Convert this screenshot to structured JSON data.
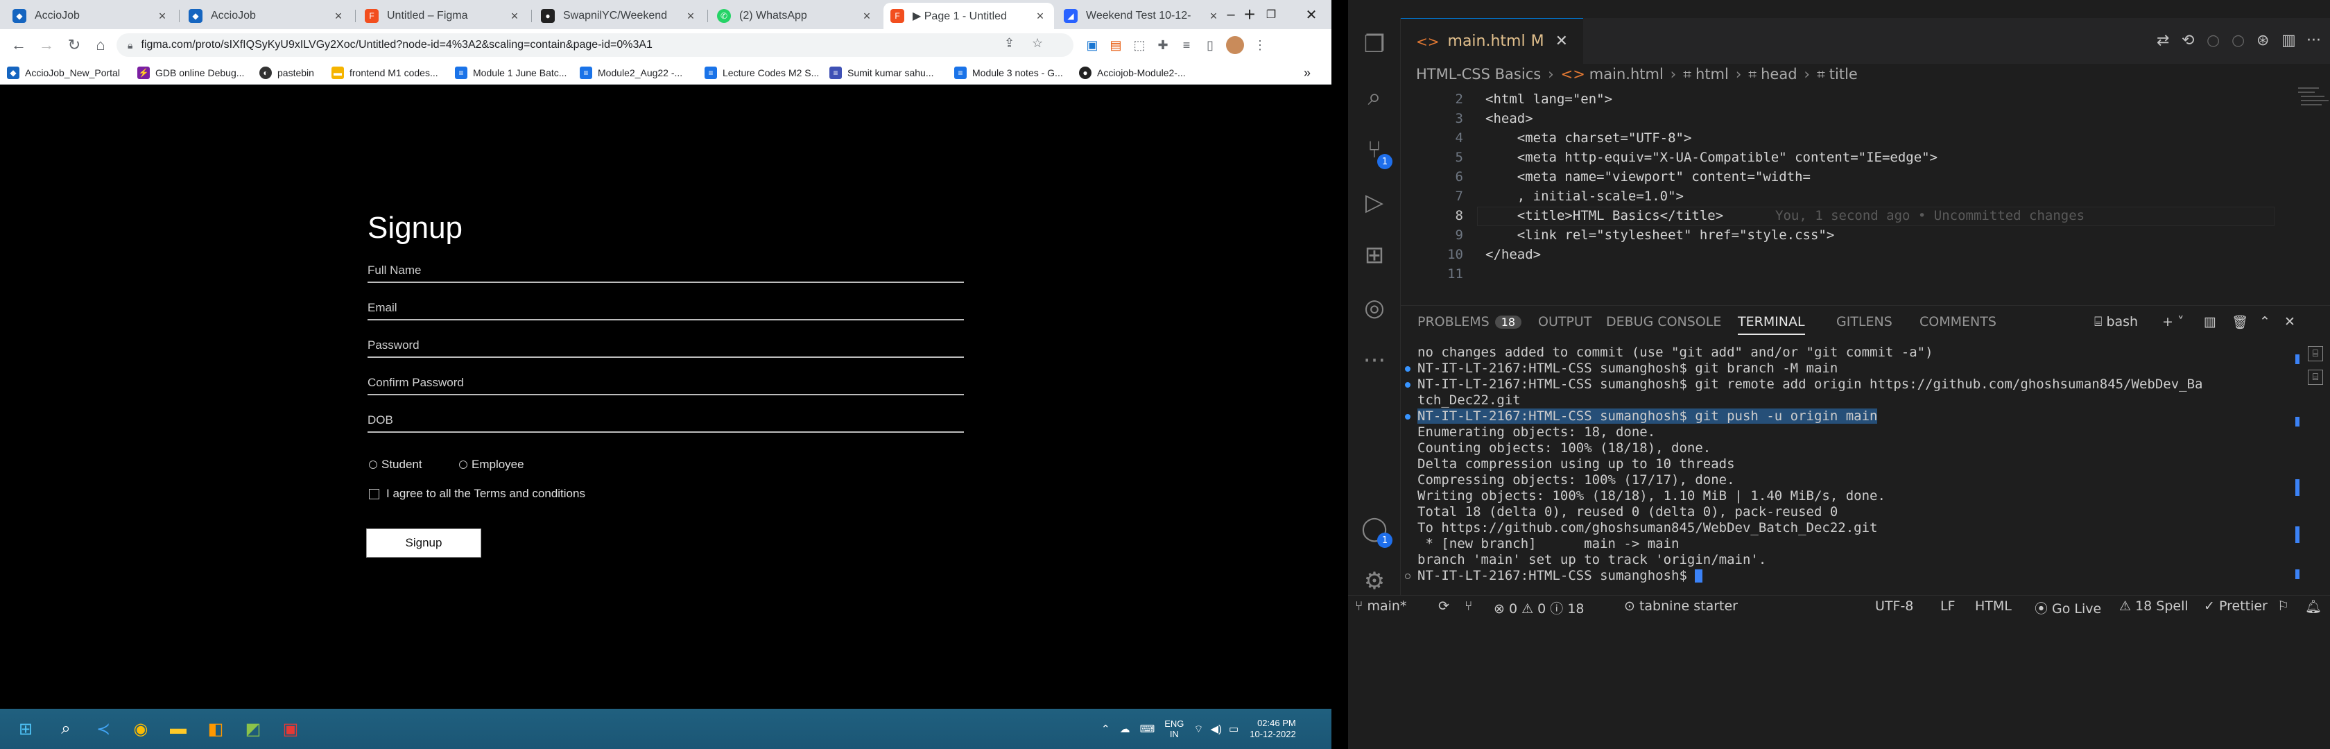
{
  "browser": {
    "tabs": [
      {
        "title": "AccioJob",
        "icon": "acciojob-icon",
        "active": false
      },
      {
        "title": "AccioJob",
        "icon": "acciojob-icon",
        "active": false
      },
      {
        "title": "Untitled – Figma",
        "icon": "figma-icon",
        "active": false
      },
      {
        "title": "SwapnilYC/Weekend",
        "icon": "github-icon",
        "active": false
      },
      {
        "title": "(2) WhatsApp",
        "icon": "whatsapp-icon",
        "active": false
      },
      {
        "title": "▶ Page 1 - Untitled",
        "icon": "figma-icon",
        "active": true
      },
      {
        "title": "Weekend Test 10-12-",
        "icon": "test-icon",
        "active": false
      }
    ],
    "url": "figma.com/proto/sIXfIQSyKyU9xILVGy2Xoc/Untitled?node-id=4%3A2&scaling=contain&page-id=0%3A1",
    "bookmarks": [
      "AccioJob_New_Portal",
      "GDB online Debug...",
      "pastebin",
      "frontend M1 codes...",
      "Module 1 June Batc...",
      "Module2_Aug22 -...",
      "Lecture Codes M2 S...",
      "Sumit kumar sahu...",
      "Module 3 notes - G...",
      "Acciojob-Module2-..."
    ],
    "more_bookmarks": "»"
  },
  "signup_form": {
    "title": "Signup",
    "fields": [
      "Full Name",
      "Email",
      "Password",
      "Confirm Password",
      "DOB"
    ],
    "radios": [
      "Student",
      "Employee"
    ],
    "checkbox_label": "I agree to all the Terms and conditions",
    "button_label": "Signup"
  },
  "taskbar": {
    "lang": "ENG",
    "region": "IN",
    "time": "02:46 PM",
    "date": "10-12-2022"
  },
  "vscode": {
    "editor_tab": {
      "filename": "main.html",
      "modified": "M"
    },
    "breadcrumb": [
      "HTML-CSS Basics",
      "main.html",
      "html",
      "head",
      "title"
    ],
    "code_lines": [
      {
        "num": "2",
        "text": "<html lang=\"en\">"
      },
      {
        "num": "3",
        "text": "<head>"
      },
      {
        "num": "4",
        "text": "    <meta charset=\"UTF-8\">"
      },
      {
        "num": "5",
        "text": "    <meta http-equiv=\"X-UA-Compatible\" content=\"IE=edge\">"
      },
      {
        "num": "6",
        "text": "    <meta name=\"viewport\" content=\"width="
      },
      {
        "num": "7",
        "text": "    , initial-scale=1.0\">"
      },
      {
        "num": "8",
        "text": "    <title>HTML Basics</title>"
      },
      {
        "num": "9",
        "text": "    <link rel=\"stylesheet\" href=\"style.css\">"
      },
      {
        "num": "10",
        "text": "</head>"
      },
      {
        "num": "11",
        "text": ""
      }
    ],
    "blame": "You, 1 second ago • Uncommitted changes",
    "panel_tabs": {
      "problems": "PROBLEMS",
      "problems_count": "18",
      "output": "OUTPUT",
      "debug": "DEBUG CONSOLE",
      "terminal": "TERMINAL",
      "gitlens": "GITLENS",
      "comments": "COMMENTS",
      "shell": "bash"
    },
    "terminal_lines": [
      "no changes added to commit (use \"git add\" and/or \"git commit -a\")",
      "NT-IT-LT-2167:HTML-CSS sumanghosh$ git branch -M main",
      "NT-IT-LT-2167:HTML-CSS sumanghosh$ git remote add origin https://github.com/ghoshsuman845/WebDev_Ba",
      "tch_Dec22.git",
      "NT-IT-LT-2167:HTML-CSS sumanghosh$ git push -u origin main",
      "Enumerating objects: 18, done.",
      "Counting objects: 100% (18/18), done.",
      "Delta compression using up to 10 threads",
      "Compressing objects: 100% (17/17), done.",
      "Writing objects: 100% (18/18), 1.10 MiB | 1.40 MiB/s, done.",
      "Total 18 (delta 0), reused 0 (delta 0), pack-reused 0",
      "To https://github.com/ghoshsuman845/WebDev_Batch_Dec22.git",
      " * [new branch]      main -> main",
      "branch 'main' set up to track 'origin/main'.",
      "NT-IT-LT-2167:HTML-CSS sumanghosh$ "
    ],
    "activity_badges": {
      "scm": "1",
      "accounts": "1"
    },
    "status": {
      "branch": "main*",
      "problems": "⊗ 0 ⚠ 0 ⓘ 18",
      "tabnine": "tabnine starter",
      "encoding": "UTF-8",
      "eol": "LF",
      "language": "HTML",
      "golive": "Go Live",
      "spell": "⚠ 18 Spell",
      "prettier": "✓ Prettier"
    }
  }
}
